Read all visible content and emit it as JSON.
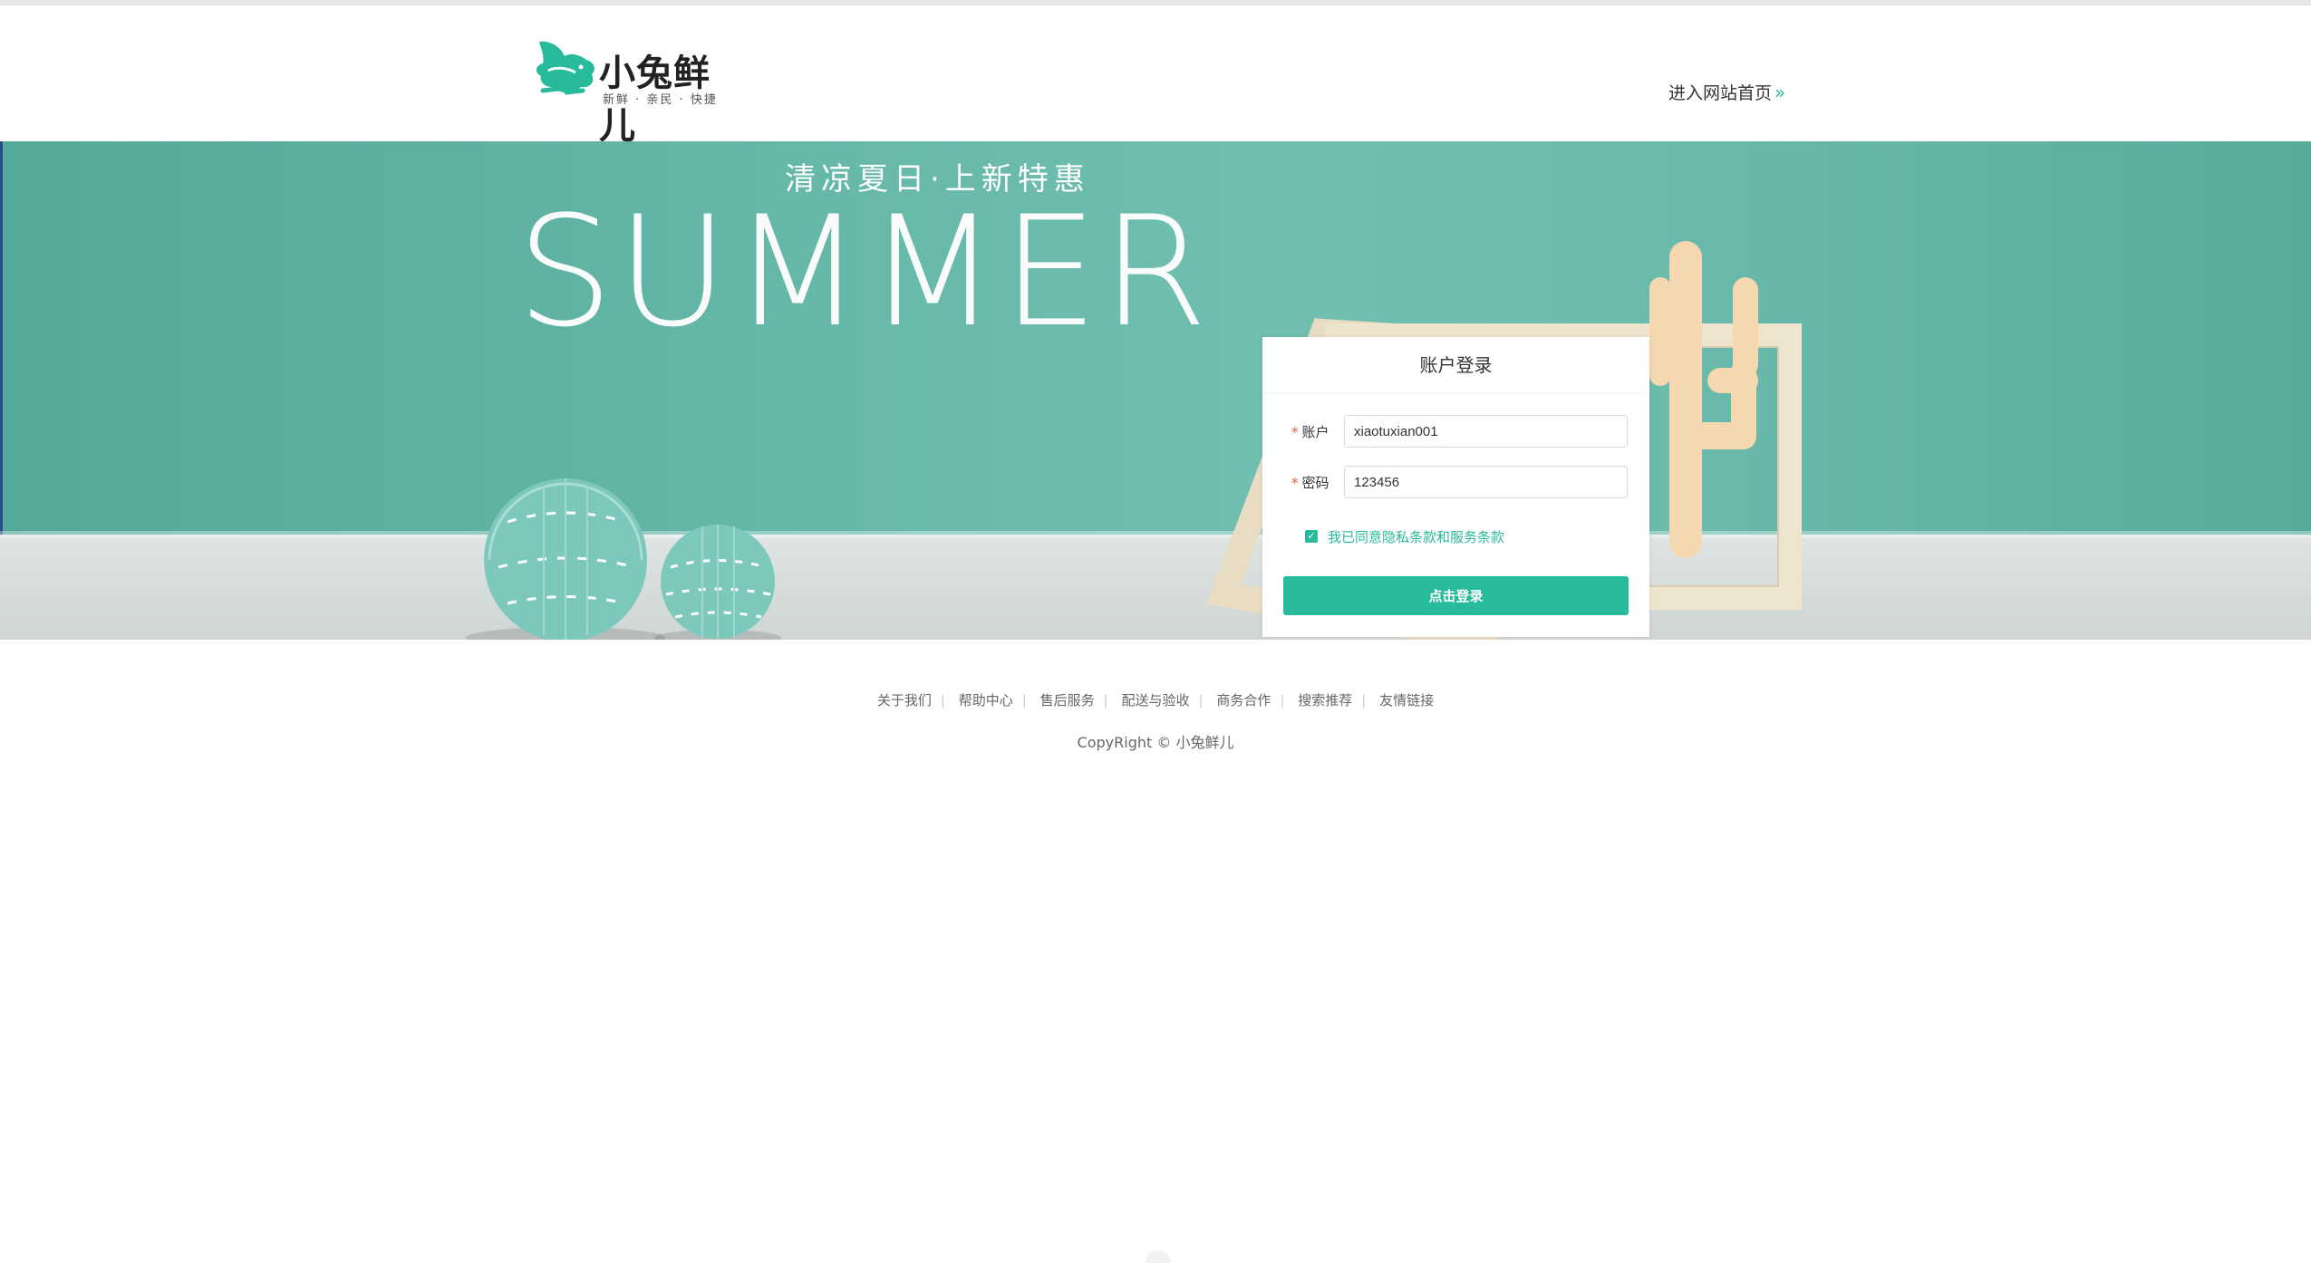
{
  "header": {
    "logo_name": "小兔鲜儿",
    "logo_slogan": "新鲜 · 亲民 · 快捷",
    "home_link": "进入网站首页",
    "home_arrow": "»"
  },
  "banner": {
    "subtitle": "清凉夏日·上新特惠",
    "title": "SUMMER"
  },
  "login": {
    "title": "账户登录",
    "account_label": "账户",
    "account_value": "xiaotuxian001",
    "password_label": "密码",
    "password_value": "123456",
    "required_mark": "*",
    "agree_text": "我已同意隐私条款和服务条款",
    "agree_checked": true,
    "submit_label": "点击登录"
  },
  "footer": {
    "links": [
      "关于我们",
      "帮助中心",
      "售后服务",
      "配送与验收",
      "商务合作",
      "搜索推荐",
      "友情链接"
    ],
    "copyright": "CopyRight © 小兔鲜儿"
  },
  "colors": {
    "accent": "#27ba9b",
    "banner_teal": "#66b8a9",
    "required": "#e26237"
  }
}
